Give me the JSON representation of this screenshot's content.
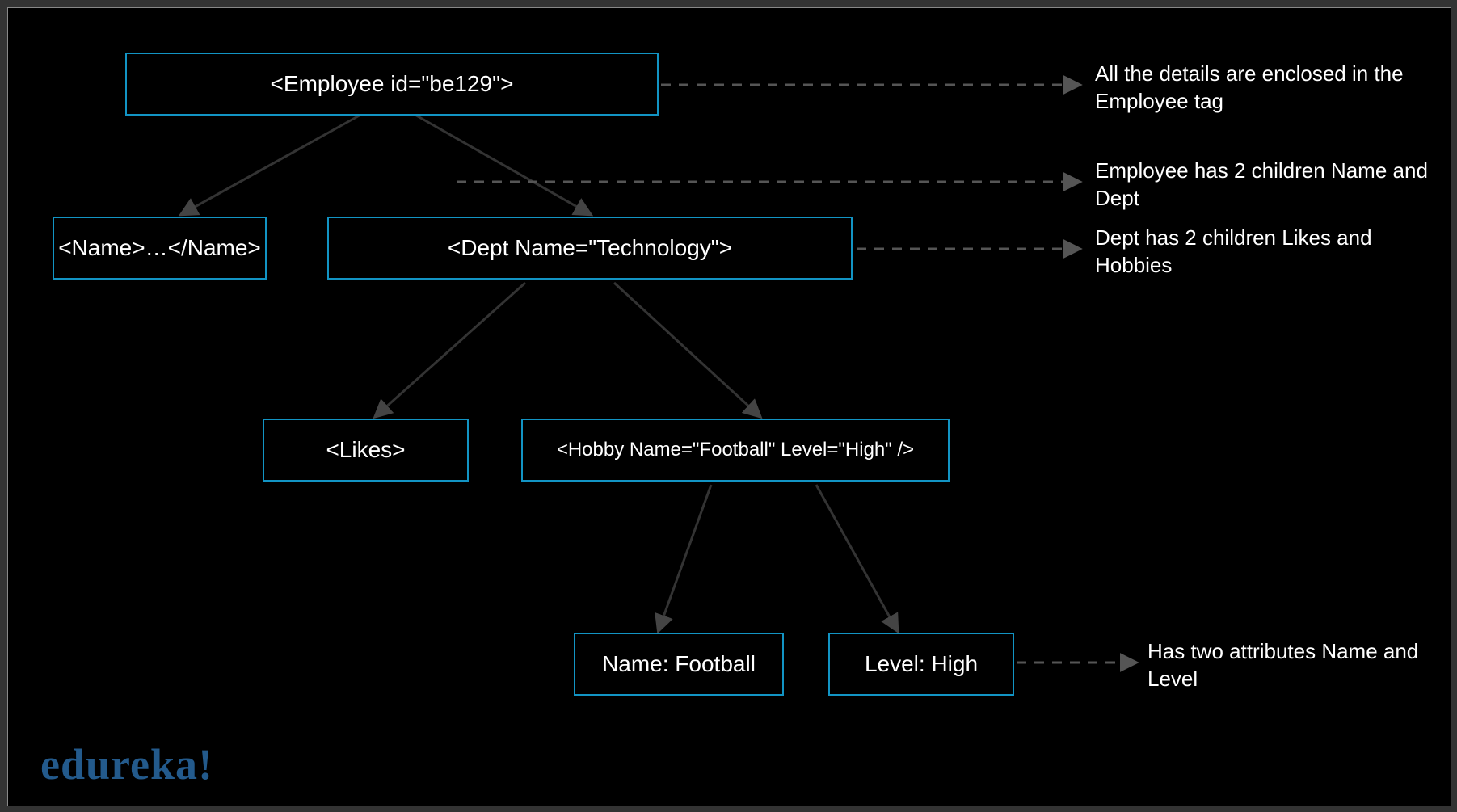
{
  "nodes": {
    "root": "<Employee id=\"be129\">",
    "name": "<Name>…</Name>",
    "dept": "<Dept Name=\"Technology\">",
    "likes": "<Likes>",
    "hobbies": "<Hobby Name=\"Football\" Level=\"High\" />",
    "hobby1": "Name: Football",
    "hobby2": "Level: High"
  },
  "annotations": {
    "a1": "All the details are enclosed in the Employee tag",
    "a2": "Employee has 2 children Name and Dept",
    "a3": "Dept has 2 children Likes and Hobbies",
    "a4": "Has two attributes Name and Level"
  },
  "logo": "edureka!",
  "colors": {
    "box_border": "#1294c4",
    "logo": "#235a8c"
  }
}
